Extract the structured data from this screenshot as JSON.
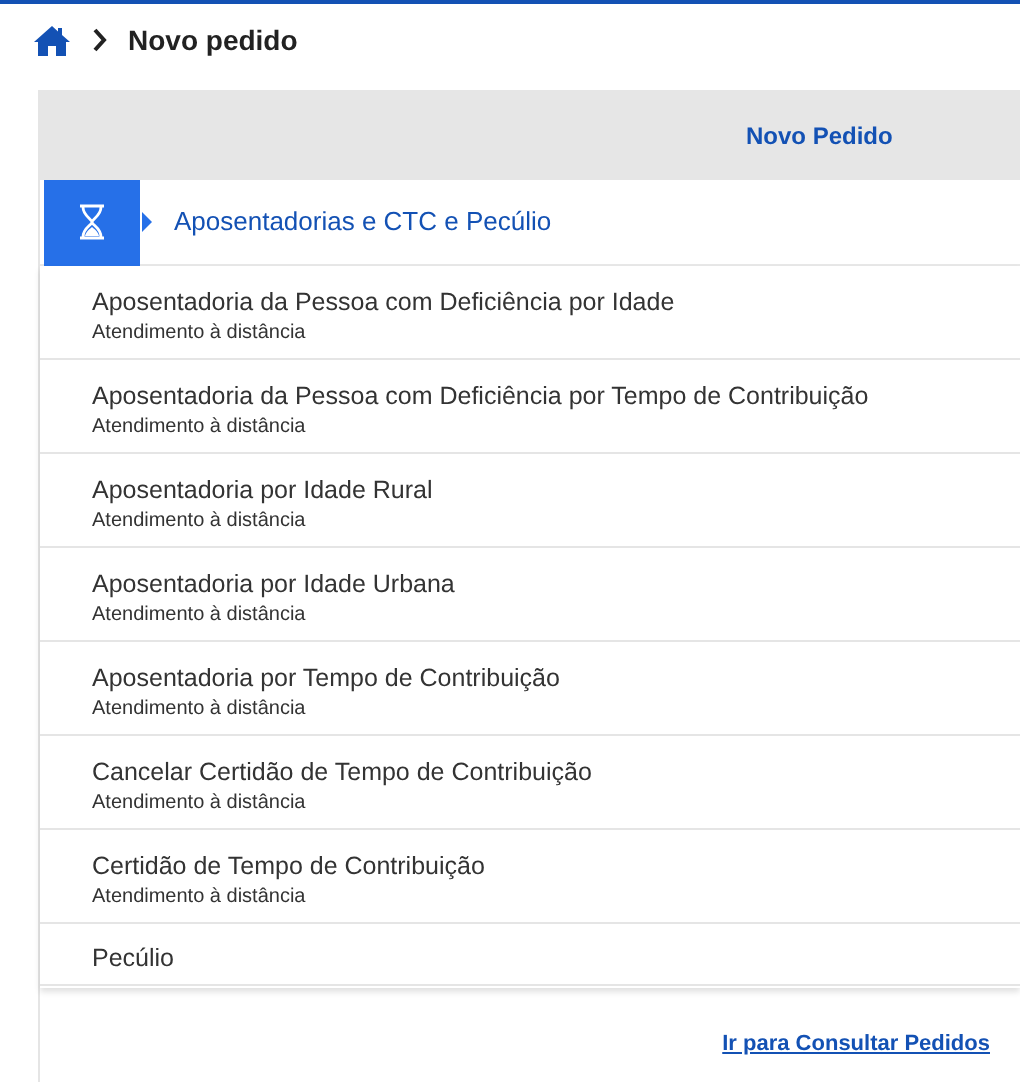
{
  "breadcrumb": {
    "current": "Novo pedido"
  },
  "panel": {
    "title": "Novo Pedido"
  },
  "category": {
    "label": "Aposentadorias e CTC e Pecúlio",
    "expanded": true
  },
  "services": [
    {
      "title": "Aposentadoria da Pessoa com Deficiência por Idade",
      "subtitle": "Atendimento à distância"
    },
    {
      "title": "Aposentadoria da Pessoa com Deficiência por Tempo de Contribuição",
      "subtitle": "Atendimento à distância"
    },
    {
      "title": "Aposentadoria por Idade Rural",
      "subtitle": "Atendimento à distância"
    },
    {
      "title": "Aposentadoria por Idade Urbana",
      "subtitle": "Atendimento à distância"
    },
    {
      "title": "Aposentadoria por Tempo de Contribuição",
      "subtitle": "Atendimento à distância"
    },
    {
      "title": "Cancelar Certidão de Tempo de Contribuição",
      "subtitle": "Atendimento à distância"
    },
    {
      "title": "Certidão de Tempo de Contribuição",
      "subtitle": "Atendimento à distância"
    },
    {
      "title": "Pecúlio"
    }
  ],
  "footer_link": "Ir para Consultar Pedidos"
}
